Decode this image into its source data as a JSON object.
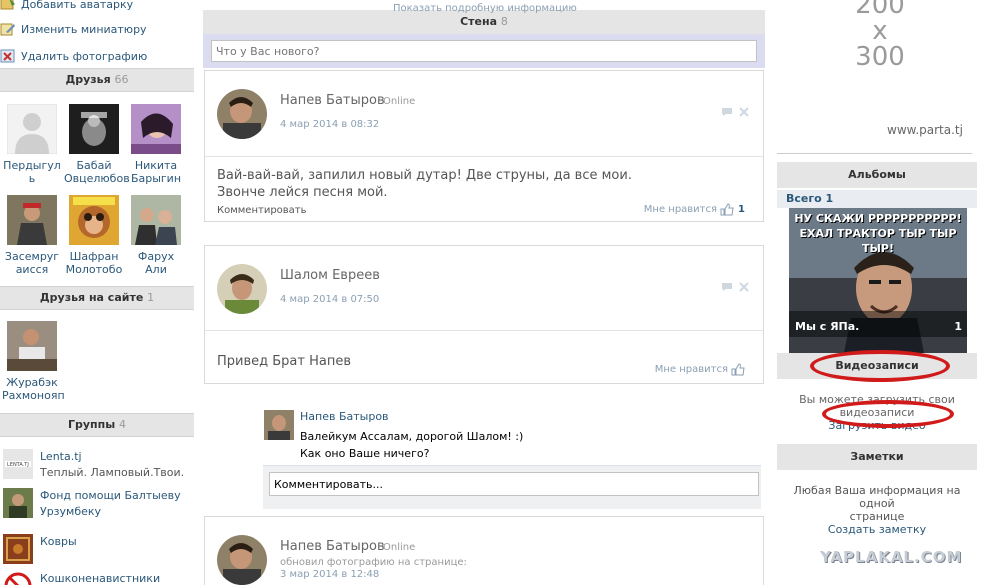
{
  "left": {
    "links": [
      {
        "label": "Добавить аватарку",
        "icon": "add-avatar-icon"
      },
      {
        "label": "Изменить миниатюру",
        "icon": "edit-thumbnail-icon"
      },
      {
        "label": "Удалить фотографию",
        "icon": "delete-photo-icon"
      }
    ],
    "friends": {
      "title": "Друзья",
      "count": "66",
      "items": [
        {
          "name": "Пердыгул ь"
        },
        {
          "name": "Бабай Овцелюбов"
        },
        {
          "name": "Никита Барыгин"
        },
        {
          "name": "Засемруг аисся"
        },
        {
          "name": "Шафран Молотобо"
        },
        {
          "name": "Фарух Али"
        }
      ]
    },
    "online_friends": {
      "title": "Друзья на сайте",
      "count": "1",
      "items": [
        {
          "name": "Журабэк Рахмонояп"
        }
      ]
    },
    "groups": {
      "title": "Группы",
      "count": "4",
      "items": [
        {
          "name": "Lenta.tj",
          "desc": "Теплый. Ламповый.Твои."
        },
        {
          "name": "Фонд помощи Балтыеву Урзумбеку",
          "desc": ""
        },
        {
          "name": "Ковры",
          "desc": ""
        },
        {
          "name": "Кошконенавистники",
          "desc": ""
        }
      ]
    }
  },
  "wall": {
    "top_note": "Показать подробную информацию",
    "title": "Стена",
    "count": "8",
    "new_post_placeholder": "Что у Вас нового?",
    "posts": [
      {
        "author": "Напев Батыров",
        "status": "Online",
        "date": "4 мар 2014 в 08:32",
        "text_line1": "Вай-вай-вай, запилил новый дутар! Две струны, да все мои.",
        "text_line2": "Звонче лейся песня мой.",
        "comment_label": "Комментировать",
        "like_label": "Мне нравится",
        "like_count": "1"
      },
      {
        "author": "Шалом Евреев",
        "date": "4 мар 2014 в 07:50",
        "text": "Привед Брат Напев",
        "like_label": "Мне нравится"
      },
      {
        "author": "Напев Батыров",
        "status": "Online",
        "subtitle": "обновил фотографию на странице:",
        "date": "3 мар 2014 в 12:48"
      }
    ],
    "reply": {
      "author": "Напев Батыров",
      "line1": "Валейкум Ассалам, дорогой Шалом! :)",
      "line2": "Как оно Ваше ничего?",
      "comment_placeholder": "Комментировать..."
    }
  },
  "right": {
    "ad": {
      "line1": "200",
      "line2": "x",
      "line3": "300",
      "site": "www.parta.tj"
    },
    "albums": {
      "title": "Альбомы",
      "total": "Всего 1",
      "meme_line1": "НУ СКАЖИ РРРРРРРРРРР!",
      "meme_line2": "ЕХАЛ ТРАКТОР ТЫР ТЫР ТЫР!",
      "album_name": "Мы с ЯПа.",
      "album_count": "1"
    },
    "videos": {
      "title": "Видеозаписи",
      "text_line1": "Вы можете загрузить свои",
      "text_line2": "видеозаписи",
      "upload_label": "Загрузить видео"
    },
    "notes": {
      "title": "Заметки",
      "text_line1": "Любая Ваша информация на одной",
      "text_line2": "странице",
      "create_label": "Создать заметку"
    },
    "watermark": "YAPLAKAL.COM"
  },
  "colors": {
    "link": "#2b587a",
    "header_bg": "#e5e5e5",
    "highlight": "#d11a1a"
  }
}
